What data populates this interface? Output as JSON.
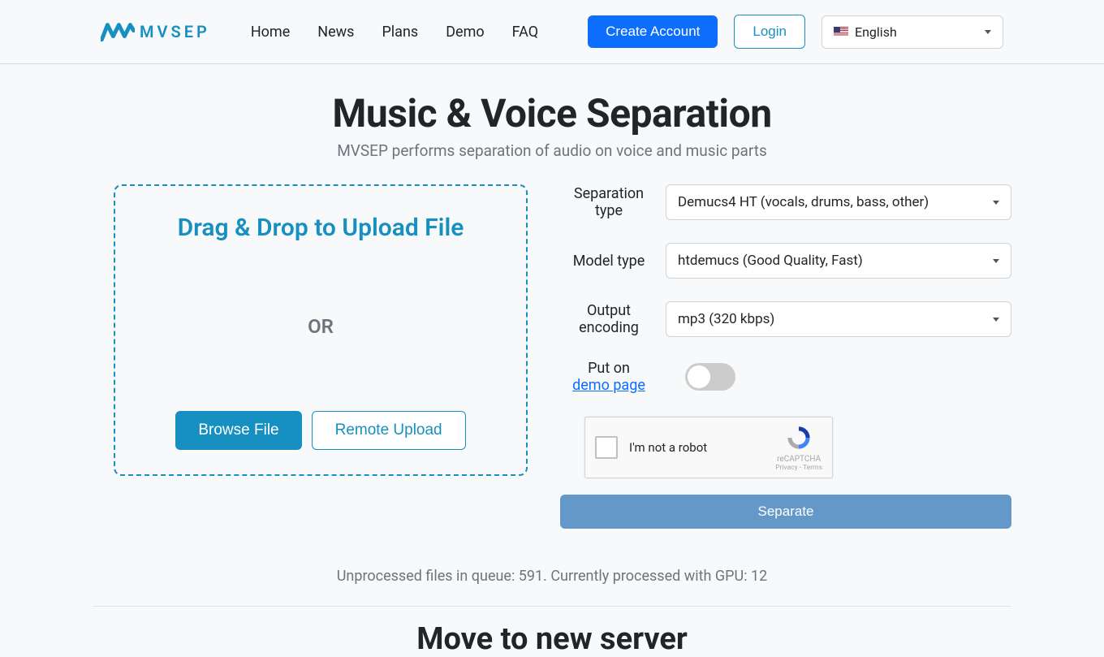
{
  "brand": "MVSEP",
  "nav": {
    "home": "Home",
    "news": "News",
    "plans": "Plans",
    "demo": "Demo",
    "faq": "FAQ"
  },
  "header": {
    "create_account": "Create Account",
    "login": "Login",
    "language": "English"
  },
  "hero": {
    "title": "Music & Voice Separation",
    "subtitle": "MVSEP performs separation of audio on voice and music parts"
  },
  "dropzone": {
    "title": "Drag & Drop to Upload File",
    "or": "OR",
    "browse": "Browse File",
    "remote": "Remote Upload"
  },
  "form": {
    "separation_type_label": "Separation type",
    "separation_type_value": "Demucs4 HT (vocals, drums, bass, other)",
    "model_type_label": "Model type",
    "model_type_value": "htdemucs (Good Quality, Fast)",
    "output_encoding_label": "Output encoding",
    "output_encoding_value": "mp3 (320 kbps)",
    "put_on_label_1": "Put on",
    "put_on_label_2": "demo page",
    "recaptcha_label": "I'm not a robot",
    "recaptcha_brand": "reCAPTCHA",
    "recaptcha_links": "Privacy - Terms",
    "separate_button": "Separate"
  },
  "queue_status": "Unprocessed files in queue: 591. Currently processed with GPU: 12",
  "news_heading": "Move to new server"
}
